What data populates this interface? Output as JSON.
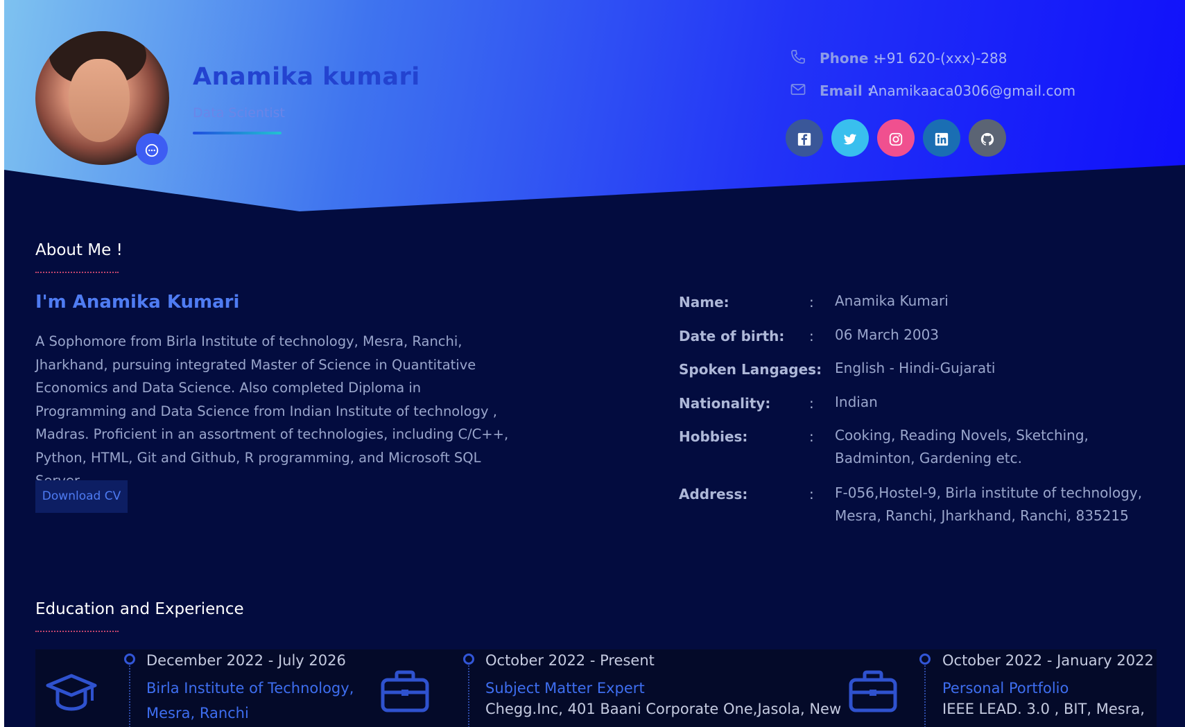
{
  "profile": {
    "name": "Anamika kumari",
    "role": "Data Scientist"
  },
  "contact": {
    "phone_label": "Phone :",
    "phone_value": "+91 620-(xxx)-288",
    "email_label": "Email :",
    "email_value": "Anamikaaca0306@gmail.com"
  },
  "socials": [
    {
      "name": "facebook",
      "glyph": "f",
      "color": "#3a5799"
    },
    {
      "name": "twitter",
      "glyph": "t",
      "color": "#39bfee"
    },
    {
      "name": "instagram",
      "glyph": "◎",
      "color": "#f0508f"
    },
    {
      "name": "linkedin",
      "glyph": "in",
      "color": "#1a6eb3"
    },
    {
      "name": "github",
      "glyph": "●",
      "color": "#5b6474"
    }
  ],
  "about": {
    "section_title": "About Me !",
    "heading": "I'm Anamika Kumari",
    "text": "A Sophomore from Birla Institute of technology, Mesra, Ranchi, Jharkhand, pursuing integrated Master of Science in Quantitative Economics and Data Science. Also completed Diploma in Programming and Data Science from Indian Institute of technology , Madras. Proficient in an assortment of technologies, including C/C++, Python, HTML, Git and Github, R programming, and Microsoft SQL Server.",
    "download_label": "Download CV"
  },
  "info": [
    {
      "key": "Name:",
      "sep": ":",
      "value": "Anamika Kumari"
    },
    {
      "key": "Date of birth:",
      "sep": ":",
      "value": "06 March 2003"
    },
    {
      "key": "Spoken Langages:",
      "sep": ":",
      "value": "English - Hindi-Gujarati"
    },
    {
      "key": "Nationality:",
      "sep": ":",
      "value": "Indian"
    },
    {
      "key": "Hobbies:",
      "sep": ":",
      "value": "Cooking, Reading Novels, Sketching, Badminton, Gardening etc."
    },
    {
      "key": "Address:",
      "sep": ":",
      "value": "F-056,Hostel-9, Birla institute of technology, Mesra, Ranchi, Jharkhand, Ranchi, 835215"
    }
  ],
  "education": {
    "section_title": "Education and Experience",
    "items": [
      {
        "icon": "graduation-cap-icon",
        "date": "December 2022 - July 2026",
        "title": "Birla Institute of Technology, Mesra, Ranchi",
        "org": ""
      },
      {
        "icon": "briefcase-icon",
        "date": "October 2022 - Present",
        "title": "Subject Matter Expert",
        "org": "Chegg.Inc, 401 Baani Corporate One,Jasola, New"
      },
      {
        "icon": "briefcase-icon",
        "date": "October 2022 - January 2022",
        "title": "Personal Portfolio",
        "org": "IEEE LEAD. 3.0 , BIT, Mesra,"
      }
    ]
  },
  "colors": {
    "page_bg": "#030c3f",
    "accent": "#4f7cf2",
    "hero_gradient_start": "#7ec2f0",
    "hero_gradient_end": "#1010fb"
  }
}
